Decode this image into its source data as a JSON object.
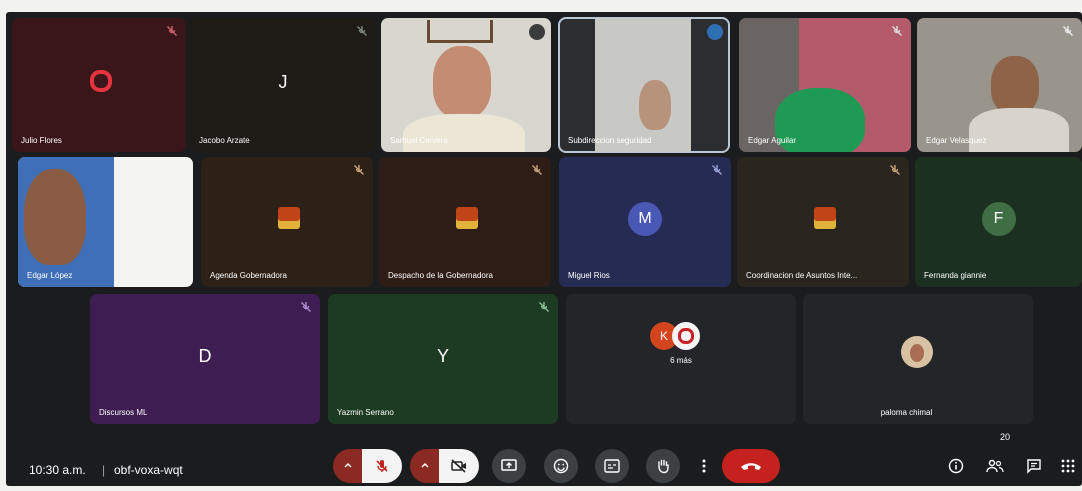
{
  "meeting": {
    "time": "10:30 a.m.",
    "separator": "|",
    "code": "obf-voxa-wqt",
    "people_count": "20"
  },
  "participants": [
    {
      "id": "julio",
      "name": "Julio Flores"
    },
    {
      "id": "jacobo",
      "name": "Jacobo Arzate",
      "letter": "J"
    },
    {
      "id": "samuel",
      "name": "Samuel Cervera"
    },
    {
      "id": "subdir",
      "name": "Subdireccion seguridad"
    },
    {
      "id": "edgaraguilar",
      "name": "Edgar Aguilar"
    },
    {
      "id": "edgarvelasquez",
      "name": "Edgar Velasquez"
    },
    {
      "id": "edgarlopez",
      "name": "Edgar López"
    },
    {
      "id": "agenda",
      "name": "Agenda Gobernadora"
    },
    {
      "id": "despacho",
      "name": "Despacho de la Gobernadora"
    },
    {
      "id": "miguel",
      "name": "Miguel Rios",
      "letter": "M"
    },
    {
      "id": "coord",
      "name": "Coordinacion de Asuntos Inte..."
    },
    {
      "id": "fernanda",
      "name": "Fernanda giannie",
      "letter": "F"
    },
    {
      "id": "discursos",
      "name": "Discursos ML",
      "letter": "D"
    },
    {
      "id": "yazmin",
      "name": "Yazmin Serrano",
      "letter": "Y"
    },
    {
      "id": "more",
      "avatar_letter": "K",
      "label": "6 más"
    },
    {
      "id": "paloma",
      "name": "paloma chimal"
    }
  ],
  "colors": {
    "julio": "#3a161a",
    "jacobo": "#1e1b17",
    "agenda": "#2d2017",
    "despacho": "#2e1d16",
    "miguel": "#262b54",
    "miguel_avatar": "#4a58b5",
    "coord": "#2a261f",
    "fernanda": "#1c3022",
    "fernanda_avatar": "#3f6e44",
    "discursos": "#3d1d52",
    "yazmin": "#1d3a22",
    "more": "#232528",
    "k_avatar": "#d4451f",
    "end_call": "#c5221f",
    "speaking_outline": "#b8c7d6"
  }
}
